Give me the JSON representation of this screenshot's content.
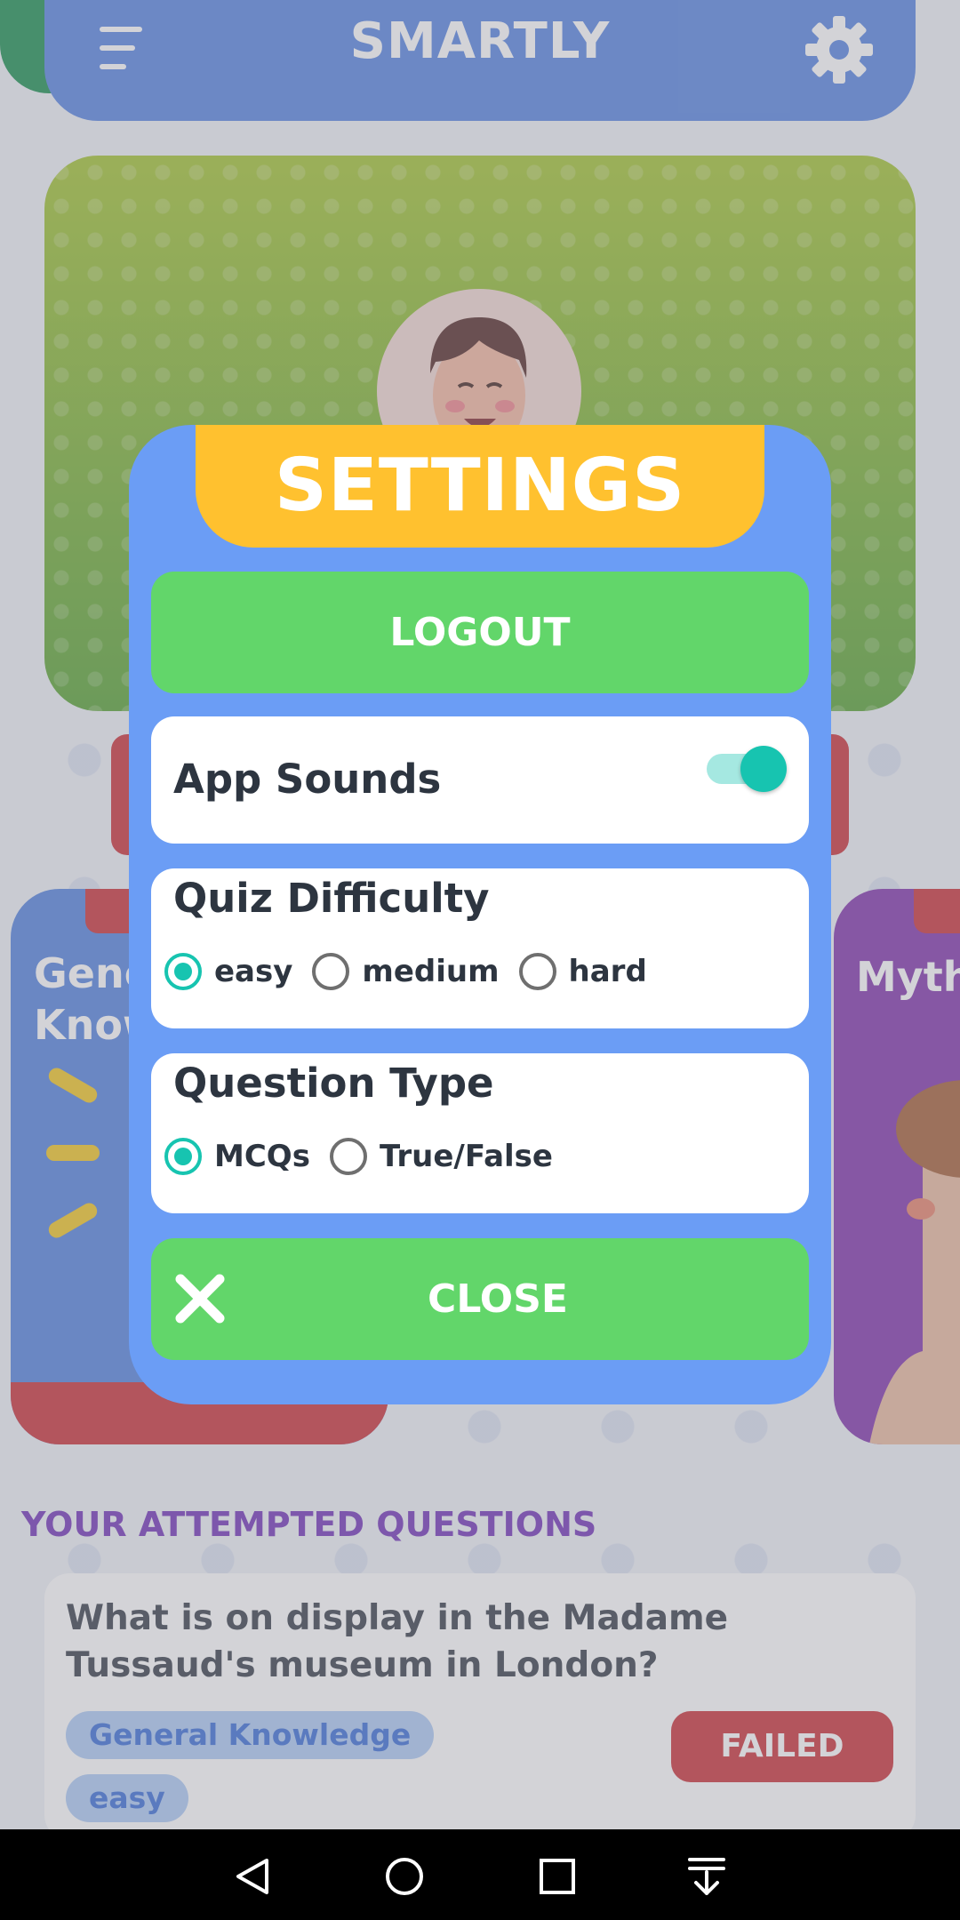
{
  "header": {
    "title": "SMARTLY"
  },
  "categories": {
    "left_title_line1": "Gene",
    "left_title_line2": "Know",
    "right_title": "Myth"
  },
  "attempted": {
    "section_title": "YOUR ATTEMPTED QUESTIONS",
    "question": "What is on display in the Madame Tussaud's museum in London?",
    "category_chip": "General Knowledge",
    "difficulty_chip": "easy",
    "status": "FAILED"
  },
  "settings": {
    "title": "SETTINGS",
    "logout_label": "LOGOUT",
    "sounds_label": "App Sounds",
    "sounds_enabled": true,
    "difficulty_label": "Quiz Difficulty",
    "difficulty_options": [
      "easy",
      "medium",
      "hard"
    ],
    "difficulty_selected": "easy",
    "type_label": "Question Type",
    "type_options": [
      "MCQs",
      "True/False"
    ],
    "type_selected": "MCQs",
    "close_label": "CLOSE"
  },
  "colors": {
    "primary_blue": "#4f7fe0",
    "accent_green": "#62d66a",
    "accent_yellow": "#ffc12f",
    "teal_selected": "#17c4b0",
    "failed_red": "#c9262d"
  },
  "navbar": {
    "icons": [
      "back-icon",
      "home-icon",
      "recents-icon",
      "notification-shade-icon"
    ]
  }
}
